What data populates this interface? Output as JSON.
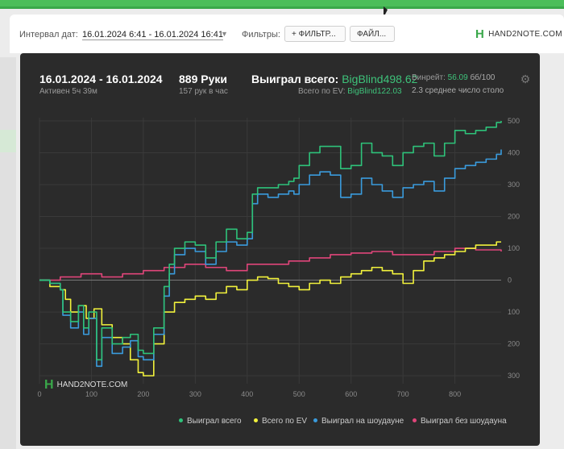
{
  "toolbar": {
    "interval_label": "Интервал дат:",
    "interval_value": "16.01.2024 6:41 - 16.01.2024 16:41",
    "filters_label": "Фильтры:",
    "filter_button": "+ ФИЛЬТР...",
    "file_button": "ФАЙЛ...",
    "logo_text": "HAND2NOTE.COM"
  },
  "stats": {
    "date_range": "16.01.2024 - 16.01.2024",
    "active": "Активен 5ч 39м",
    "hands": "889 Руки",
    "hands_per_hour": "157 рук в час",
    "won_total_label": "Выиграл всего:",
    "won_total_value": "BigBlind498.62",
    "ev_total_label": "Всего по EV:",
    "ev_total_value": "BigBlind122.03",
    "winrate_label": "Винрейт:",
    "winrate_value": "56.09",
    "winrate_per": "бб/100",
    "avg_tables": "2.3 среднее число столо"
  },
  "watermark": "HAND2NOTE.COM",
  "colors": {
    "won_total": "#2ec27a",
    "ev": "#f2f23c",
    "showdown": "#3a9bdc",
    "non_showdown": "#e0457a",
    "panel": "#2b2b2b",
    "accent": "#3ec27a"
  },
  "chart_data": {
    "type": "line",
    "xlim": [
      0,
      889
    ],
    "ylim": [
      -325,
      510
    ],
    "x_ticks": [
      0,
      100,
      200,
      300,
      400,
      500,
      600,
      700,
      800
    ],
    "y_ticks": [
      500,
      400,
      300,
      200,
      100,
      0,
      -100,
      -200,
      -300
    ],
    "y_tick_labels": [
      "500",
      "400",
      "300",
      "200",
      "100",
      "0",
      "100",
      "200",
      "300"
    ],
    "legend_position": "bottom-right",
    "grid": true,
    "series": [
      {
        "name": "Выиграл всего",
        "color": "#2ec27a",
        "x": [
          0,
          20,
          40,
          45,
          60,
          75,
          85,
          95,
          110,
          120,
          140,
          160,
          175,
          190,
          200,
          220,
          240,
          250,
          260,
          280,
          300,
          320,
          340,
          360,
          380,
          400,
          410,
          420,
          440,
          460,
          480,
          490,
          500,
          520,
          540,
          560,
          580,
          600,
          620,
          640,
          660,
          680,
          700,
          720,
          740,
          760,
          780,
          800,
          820,
          840,
          860,
          880,
          889
        ],
        "y": [
          0,
          -10,
          -30,
          -100,
          -130,
          -80,
          -150,
          -100,
          -250,
          -150,
          -200,
          -180,
          -170,
          -220,
          -230,
          -150,
          -20,
          50,
          100,
          120,
          110,
          70,
          120,
          160,
          130,
          150,
          270,
          290,
          290,
          300,
          310,
          320,
          360,
          400,
          420,
          420,
          350,
          360,
          430,
          400,
          390,
          360,
          400,
          420,
          430,
          390,
          430,
          470,
          460,
          470,
          480,
          495,
          500
        ]
      },
      {
        "name": "Выиграл на шоудауне",
        "color": "#3a9bdc",
        "x": [
          0,
          20,
          40,
          45,
          60,
          75,
          85,
          95,
          110,
          120,
          140,
          160,
          175,
          190,
          200,
          220,
          240,
          250,
          260,
          280,
          300,
          320,
          340,
          360,
          380,
          400,
          410,
          420,
          440,
          460,
          480,
          490,
          500,
          520,
          540,
          560,
          580,
          600,
          620,
          640,
          660,
          680,
          700,
          720,
          740,
          760,
          780,
          800,
          820,
          840,
          860,
          880,
          889
        ],
        "y": [
          0,
          -10,
          -30,
          -110,
          -150,
          -100,
          -170,
          -120,
          -270,
          -180,
          -230,
          -210,
          -190,
          -240,
          -250,
          -170,
          -50,
          20,
          80,
          100,
          90,
          50,
          90,
          120,
          110,
          130,
          240,
          270,
          260,
          270,
          280,
          270,
          300,
          330,
          340,
          330,
          260,
          270,
          320,
          300,
          280,
          260,
          290,
          300,
          310,
          280,
          320,
          350,
          360,
          370,
          380,
          395,
          410
        ]
      },
      {
        "name": "Всего по EV",
        "color": "#f2f23c",
        "x": [
          0,
          20,
          40,
          50,
          60,
          75,
          90,
          105,
          120,
          140,
          160,
          175,
          190,
          200,
          220,
          240,
          260,
          280,
          300,
          320,
          340,
          360,
          380,
          400,
          420,
          440,
          460,
          480,
          500,
          520,
          540,
          560,
          580,
          600,
          620,
          640,
          660,
          680,
          700,
          720,
          740,
          760,
          780,
          800,
          820,
          840,
          860,
          880,
          889
        ],
        "y": [
          0,
          -20,
          -30,
          -60,
          -100,
          -80,
          -120,
          -90,
          -140,
          -180,
          -200,
          -250,
          -290,
          -300,
          -200,
          -100,
          -70,
          -60,
          -50,
          -60,
          -40,
          -20,
          -30,
          0,
          10,
          5,
          -10,
          -20,
          -30,
          -10,
          0,
          -10,
          10,
          20,
          30,
          40,
          30,
          20,
          -10,
          30,
          60,
          70,
          80,
          90,
          100,
          110,
          110,
          120,
          120
        ]
      },
      {
        "name": "Выиграл без шоудауна",
        "color": "#e0457a",
        "x": [
          0,
          40,
          80,
          120,
          160,
          200,
          240,
          280,
          320,
          360,
          400,
          440,
          480,
          520,
          560,
          600,
          640,
          680,
          720,
          760,
          800,
          840,
          889
        ],
        "y": [
          0,
          10,
          20,
          10,
          20,
          30,
          40,
          50,
          40,
          30,
          50,
          50,
          60,
          70,
          80,
          85,
          90,
          80,
          80,
          90,
          100,
          95,
          90
        ]
      }
    ]
  }
}
